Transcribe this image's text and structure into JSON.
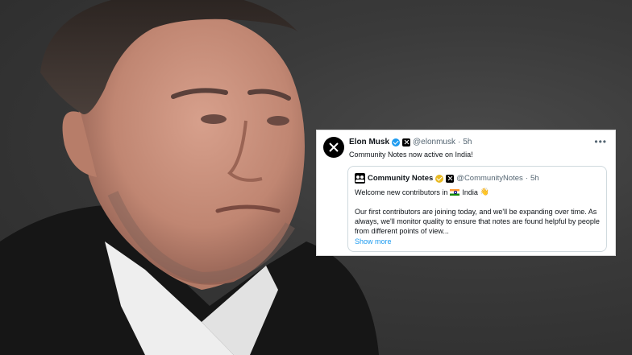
{
  "tweet": {
    "author_name": "Elon Musk",
    "author_handle": "@elonmusk",
    "time": "5h",
    "text": "Community Notes now active on India!",
    "more_icon": "more-horizontal-icon",
    "quote": {
      "author_name": "Community Notes",
      "author_handle": "@CommunityNotes",
      "time": "5h",
      "line1_prefix": "Welcome new contributors in",
      "line1_country": "India",
      "body": "Our first contributors are joining today, and we'll be expanding over time. As always, we'll monitor quality to ensure that notes are found helpful by people from different points of view...",
      "show_more": "Show more"
    }
  },
  "colors": {
    "verified_blue": "#1d9bf0",
    "verified_gold": "#e8b923",
    "link": "#1d9bf0",
    "muted": "#536471"
  }
}
